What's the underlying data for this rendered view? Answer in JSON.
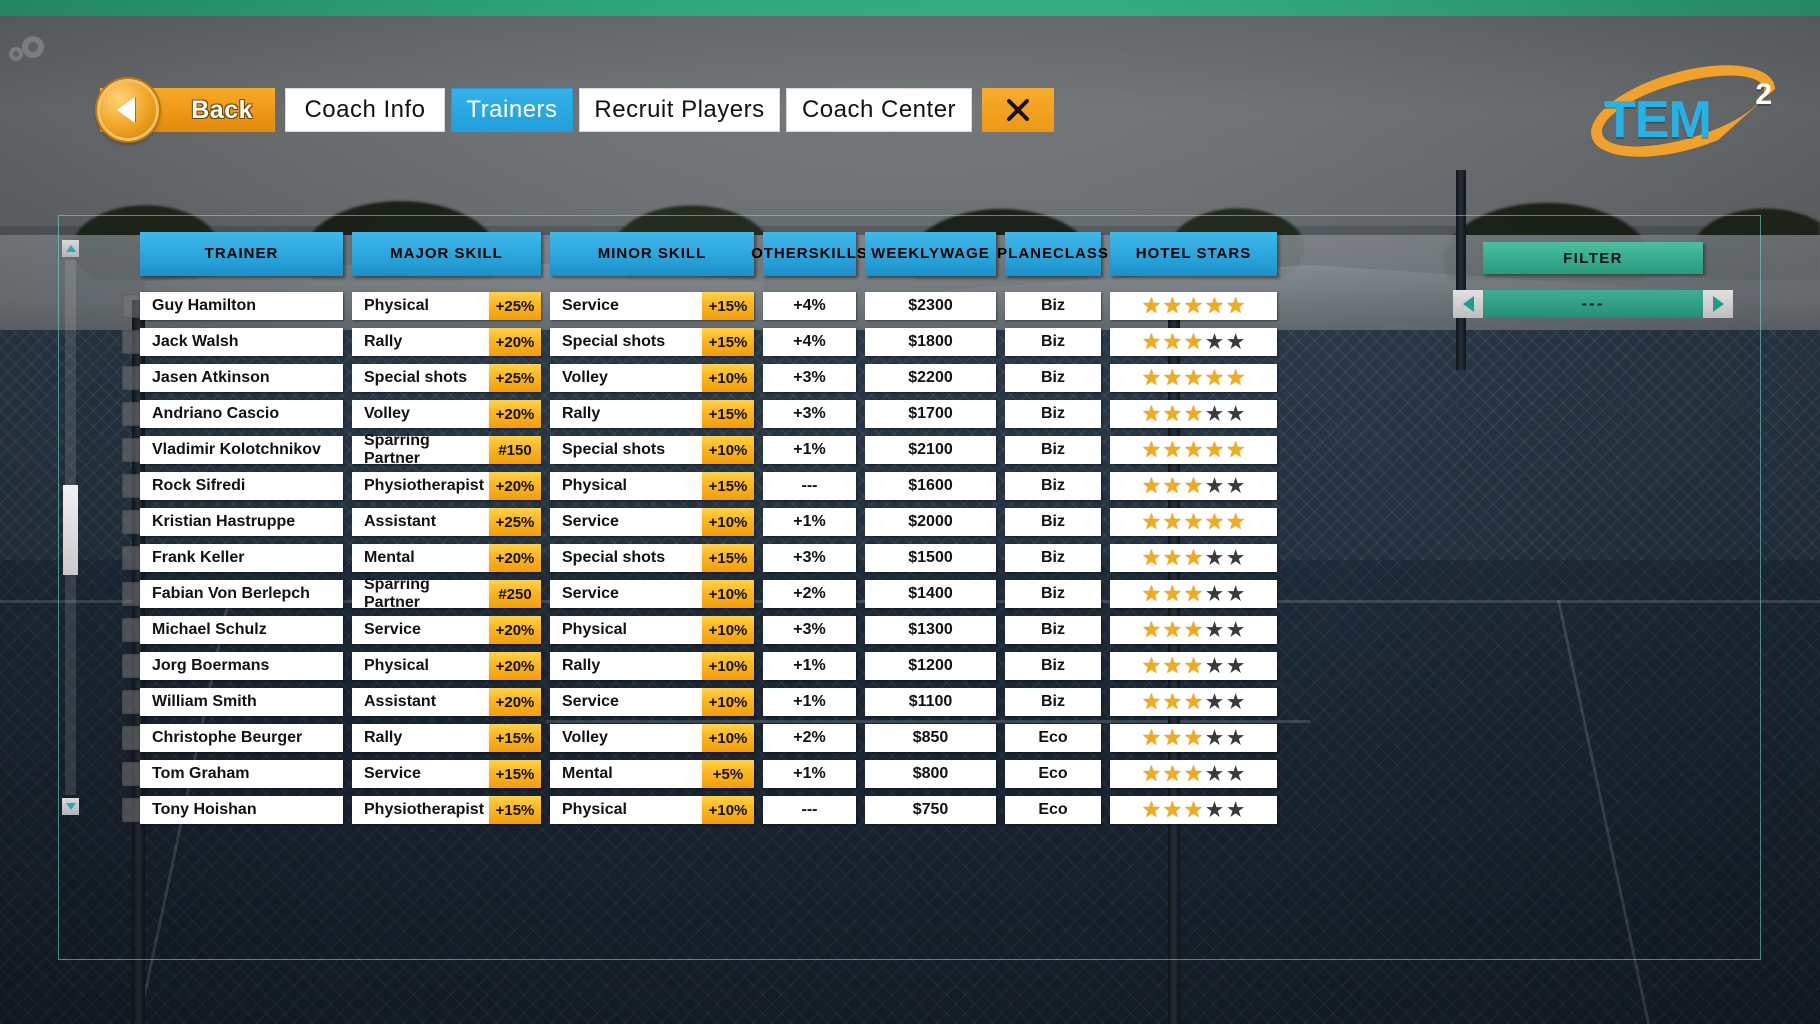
{
  "nav": {
    "back_label": "Back",
    "back_icon": "left-arrow-icon",
    "close_icon": "close-icon",
    "tabs": [
      {
        "label": "Coach Info",
        "active": false
      },
      {
        "label": "Trainers",
        "active": true
      },
      {
        "label": "Recruit Players",
        "active": false
      },
      {
        "label": "Coach Center",
        "active": false
      }
    ]
  },
  "logo": {
    "text": "TEM",
    "superscript": "2"
  },
  "colors": {
    "accent_blue": "#2ba5dc",
    "accent_orange": "#f2a22a",
    "badge_gold": "#fcb61f",
    "filter_teal": "#35a98c",
    "star_on": "#f5ab12",
    "star_off": "#3a3a3a"
  },
  "filter": {
    "title": "FILTER",
    "value": "---",
    "prev_icon": "chevron-left-icon",
    "next_icon": "chevron-right-icon"
  },
  "scrollbar": {
    "up_icon": "chevron-up-icon",
    "down_icon": "chevron-down-icon"
  },
  "table": {
    "headers": [
      "TRAINER",
      "MAJOR SKILL",
      "MINOR SKILL",
      "OTHER\nSKILLS",
      "WEEKLY\nWAGE",
      "PLANE\nCLASS",
      "HOTEL STARS"
    ],
    "rows": [
      {
        "trainer": "Guy  Hamilton",
        "major": "Physical",
        "major_val": "+25%",
        "minor": "Service",
        "minor_val": "+15%",
        "other": "+4%",
        "wage": "$2300",
        "plane": "Biz",
        "stars": 5
      },
      {
        "trainer": "Jack  Walsh",
        "major": "Rally",
        "major_val": "+20%",
        "minor": "Special shots",
        "minor_val": "+15%",
        "other": "+4%",
        "wage": "$1800",
        "plane": "Biz",
        "stars": 3
      },
      {
        "trainer": "Jasen  Atkinson",
        "major": "Special shots",
        "major_val": "+25%",
        "minor": "Volley",
        "minor_val": "+10%",
        "other": "+3%",
        "wage": "$2200",
        "plane": "Biz",
        "stars": 5
      },
      {
        "trainer": "Andriano  Cascio",
        "major": "Volley",
        "major_val": "+20%",
        "minor": "Rally",
        "minor_val": "+15%",
        "other": "+3%",
        "wage": "$1700",
        "plane": "Biz",
        "stars": 3
      },
      {
        "trainer": "Vladimir  Kolotchnikov",
        "major": "Sparring Partner",
        "major_val": "#150",
        "minor": "Special shots",
        "minor_val": "+10%",
        "other": "+1%",
        "wage": "$2100",
        "plane": "Biz",
        "stars": 5
      },
      {
        "trainer": "Rock  Sifredi",
        "major": "Physiotherapist",
        "major_val": "+20%",
        "minor": "Physical",
        "minor_val": "+15%",
        "other": "---",
        "wage": "$1600",
        "plane": "Biz",
        "stars": 3
      },
      {
        "trainer": "Kristian  Hastruppe",
        "major": "Assistant",
        "major_val": "+25%",
        "minor": "Service",
        "minor_val": "+10%",
        "other": "+1%",
        "wage": "$2000",
        "plane": "Biz",
        "stars": 5
      },
      {
        "trainer": "Frank  Keller",
        "major": "Mental",
        "major_val": "+20%",
        "minor": "Special shots",
        "minor_val": "+15%",
        "other": "+3%",
        "wage": "$1500",
        "plane": "Biz",
        "stars": 3
      },
      {
        "trainer": "Fabian  Von  Berlepch",
        "major": "Sparring Partner",
        "major_val": "#250",
        "minor": "Service",
        "minor_val": "+10%",
        "other": "+2%",
        "wage": "$1400",
        "plane": "Biz",
        "stars": 3
      },
      {
        "trainer": "Michael  Schulz",
        "major": "Service",
        "major_val": "+20%",
        "minor": "Physical",
        "minor_val": "+10%",
        "other": "+3%",
        "wage": "$1300",
        "plane": "Biz",
        "stars": 3
      },
      {
        "trainer": "Jorg  Boermans",
        "major": "Physical",
        "major_val": "+20%",
        "minor": "Rally",
        "minor_val": "+10%",
        "other": "+1%",
        "wage": "$1200",
        "plane": "Biz",
        "stars": 3
      },
      {
        "trainer": "William  Smith",
        "major": "Assistant",
        "major_val": "+20%",
        "minor": "Service",
        "minor_val": "+10%",
        "other": "+1%",
        "wage": "$1100",
        "plane": "Biz",
        "stars": 3
      },
      {
        "trainer": "Christophe  Beurger",
        "major": "Rally",
        "major_val": "+15%",
        "minor": "Volley",
        "minor_val": "+10%",
        "other": "+2%",
        "wage": "$850",
        "plane": "Eco",
        "stars": 3
      },
      {
        "trainer": "Tom  Graham",
        "major": "Service",
        "major_val": "+15%",
        "minor": "Mental",
        "minor_val": "+5%",
        "other": "+1%",
        "wage": "$800",
        "plane": "Eco",
        "stars": 3
      },
      {
        "trainer": "Tony  Hoishan",
        "major": "Physiotherapist",
        "major_val": "+15%",
        "minor": "Physical",
        "minor_val": "+10%",
        "other": "---",
        "wage": "$750",
        "plane": "Eco",
        "stars": 3
      }
    ]
  }
}
